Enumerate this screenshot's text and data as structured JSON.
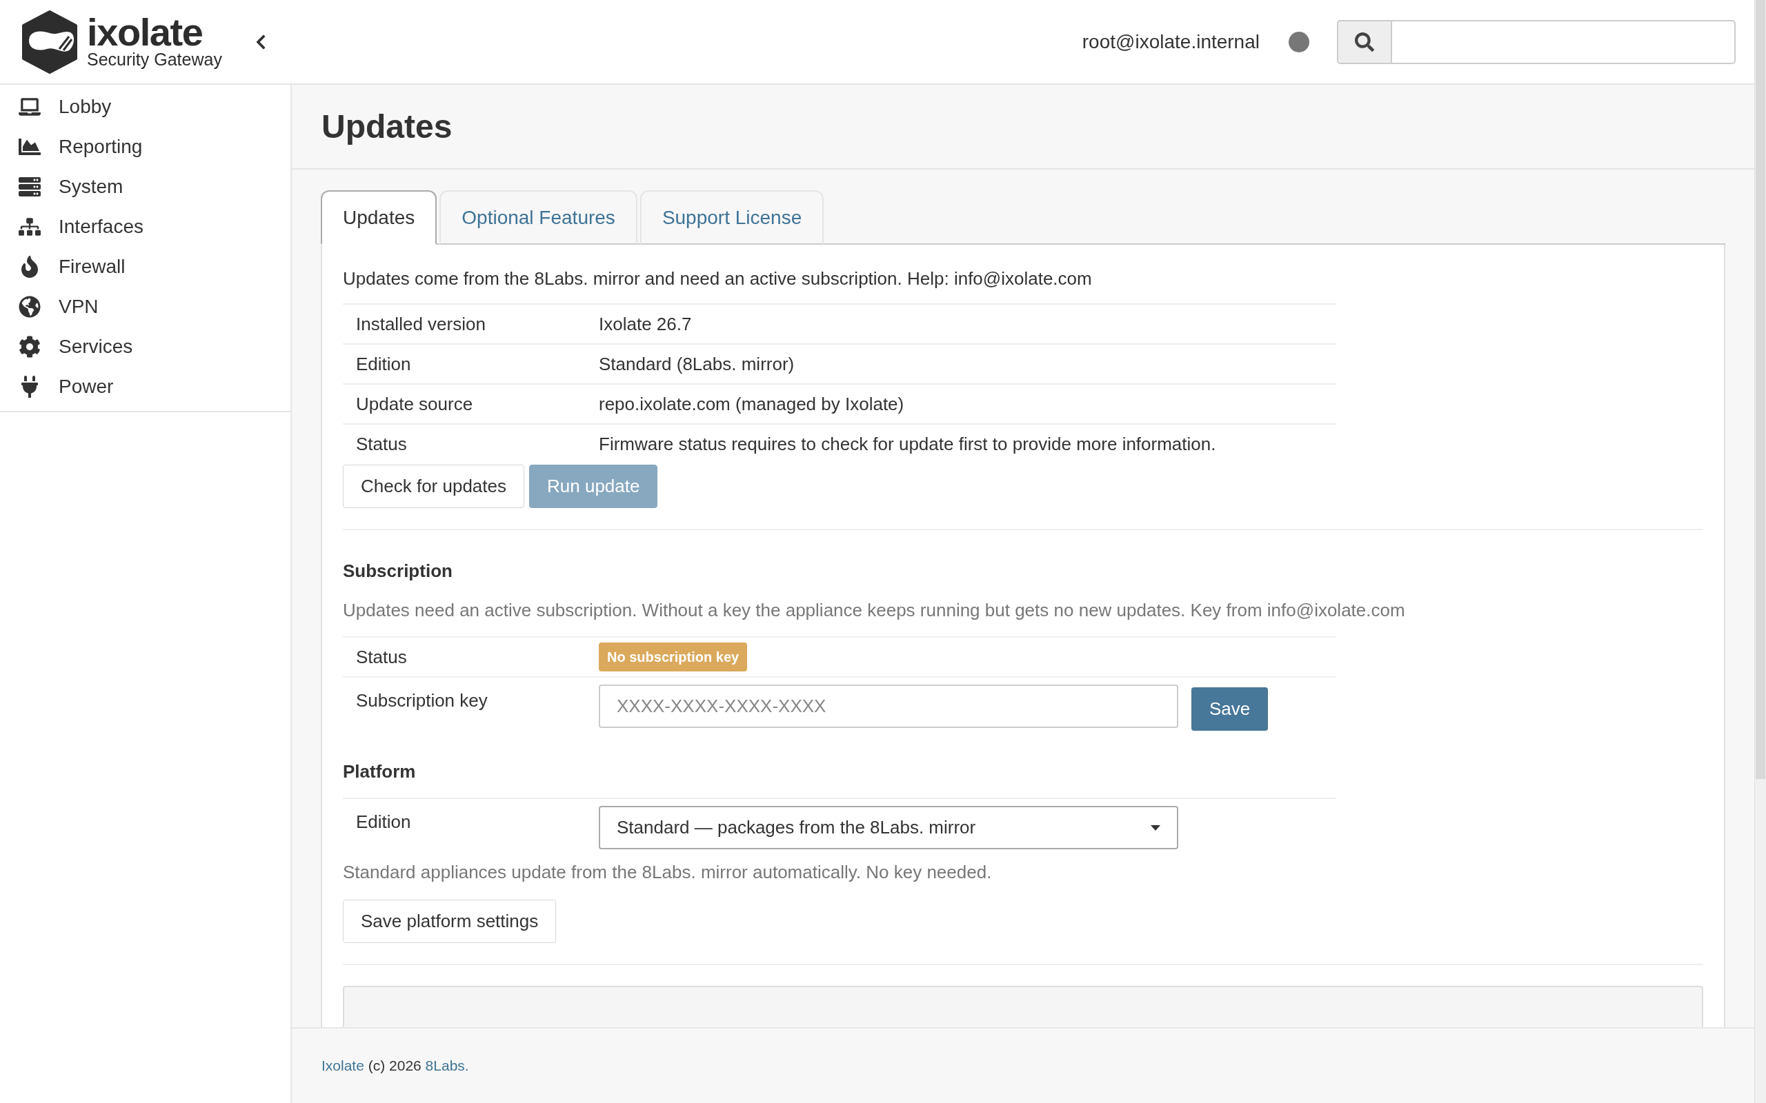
{
  "brand": {
    "name": "ixolate",
    "tagline": "Security Gateway"
  },
  "header": {
    "user": "root@ixolate.internal"
  },
  "sidebar": {
    "items": [
      {
        "label": "Lobby"
      },
      {
        "label": "Reporting"
      },
      {
        "label": "System"
      },
      {
        "label": "Interfaces"
      },
      {
        "label": "Firewall"
      },
      {
        "label": "VPN"
      },
      {
        "label": "Services"
      },
      {
        "label": "Power"
      }
    ]
  },
  "page": {
    "title": "Updates"
  },
  "tabs": [
    {
      "label": "Updates",
      "selected": true
    },
    {
      "label": "Optional Features",
      "selected": false
    },
    {
      "label": "Support License",
      "selected": false
    }
  ],
  "intro": "Updates come from the 8Labs. mirror and need an active subscription. Help: info@ixolate.com",
  "info_rows": [
    {
      "label": "Installed version",
      "value": "Ixolate 26.7"
    },
    {
      "label": "Edition",
      "value": "Standard (8Labs. mirror)"
    },
    {
      "label": "Update source",
      "value": "repo.ixolate.com (managed by Ixolate)"
    },
    {
      "label": "Status",
      "value": "Firmware status requires to check for update first to provide more information."
    }
  ],
  "buttons": [
    {
      "label": "Check for updates",
      "kind": "default",
      "disabled": false
    },
    {
      "label": "Run update",
      "kind": "primary",
      "disabled": true
    }
  ],
  "subscription": {
    "heading": "Subscription",
    "description": "Updates need an active subscription. Without a key the appliance keeps running but gets no new updates. Key from info@ixolate.com",
    "status_label": "Status",
    "status_badge": "No subscription key",
    "key_label": "Subscription key",
    "key_placeholder": "XXXX-XXXX-XXXX-XXXX",
    "save_button": "Save"
  },
  "platform": {
    "heading": "Platform",
    "edition_label": "Edition",
    "edition_value": "Standard — packages from the 8Labs. mirror",
    "help": "Standard appliances update from the 8Labs. mirror automatically. No key needed.",
    "save_button": "Save platform settings"
  },
  "footer": {
    "product": "Ixolate",
    "copyright": "(c) 2026",
    "vendor": "8Labs."
  }
}
